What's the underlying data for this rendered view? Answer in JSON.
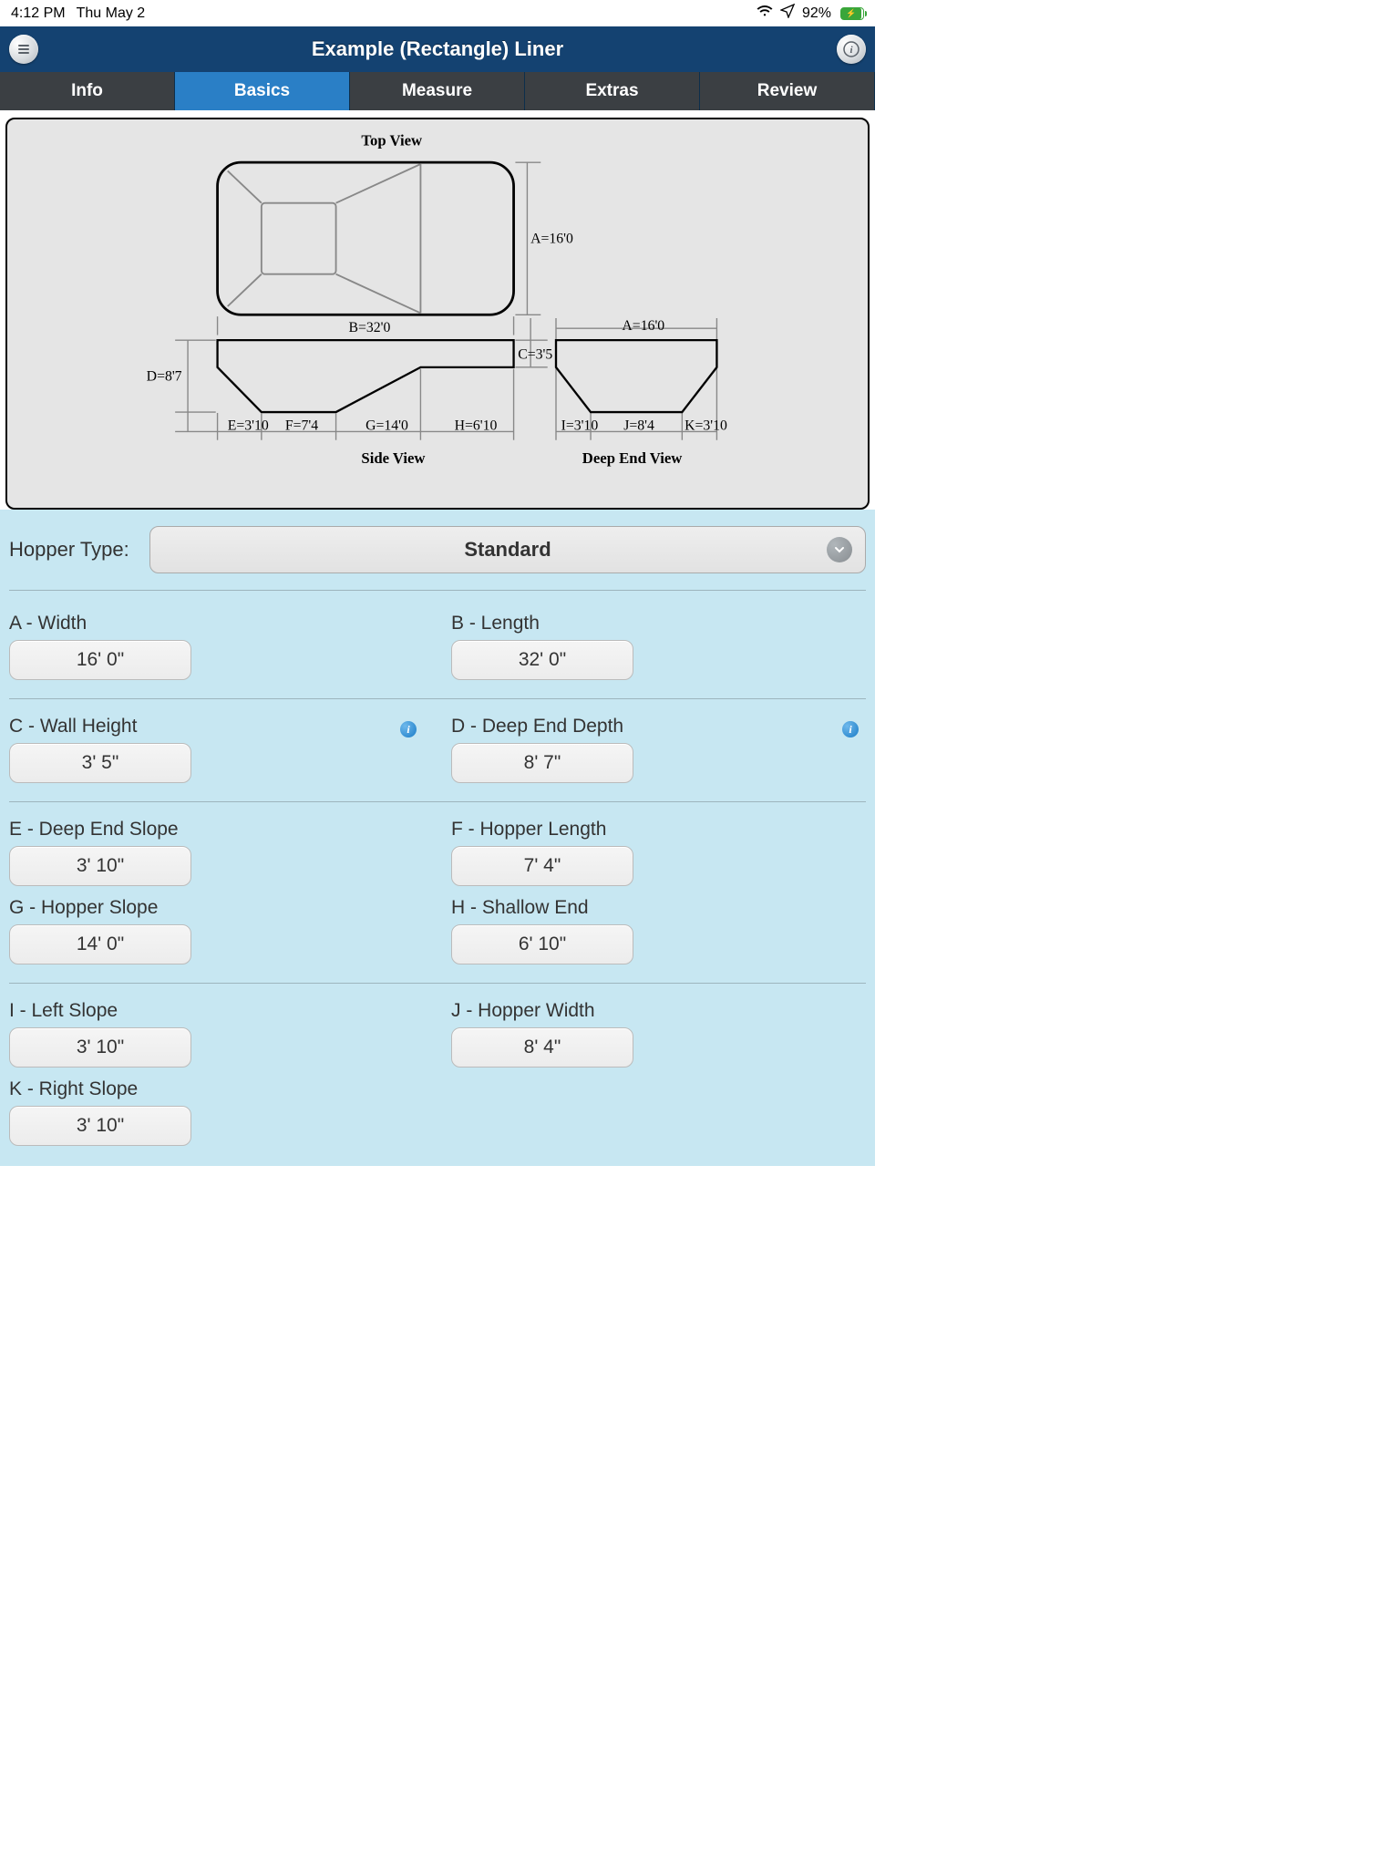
{
  "status": {
    "time": "4:12 PM",
    "date": "Thu May 2",
    "battery_pct": "92%"
  },
  "header": {
    "title": "Example (Rectangle) Liner"
  },
  "tabs": {
    "info": "Info",
    "basics": "Basics",
    "measure": "Measure",
    "extras": "Extras",
    "review": "Review"
  },
  "diagram": {
    "top_view": "Top View",
    "side_view": "Side View",
    "deep_end_view": "Deep End View",
    "labels": {
      "A_top": "A=16'0",
      "A_deep": "A=16'0",
      "B": "B=32'0",
      "C": "C=3'5",
      "D": "D=8'7",
      "E": "E=3'10",
      "F": "F=7'4",
      "G": "G=14'0",
      "H": "H=6'10",
      "I": "I=3'10",
      "J": "J=8'4",
      "K": "K=3'10"
    }
  },
  "hopper": {
    "label": "Hopper Type:",
    "value": "Standard"
  },
  "fields": {
    "A": {
      "label": "A - Width",
      "value": "16' 0\""
    },
    "B": {
      "label": "B - Length",
      "value": "32' 0\""
    },
    "C": {
      "label": "C - Wall Height",
      "value": "3' 5\""
    },
    "D": {
      "label": "D - Deep End Depth",
      "value": "8' 7\""
    },
    "E": {
      "label": "E - Deep End Slope",
      "value": "3' 10\""
    },
    "F": {
      "label": "F - Hopper Length",
      "value": "7' 4\""
    },
    "G": {
      "label": "G - Hopper Slope",
      "value": "14' 0\""
    },
    "H": {
      "label": "H - Shallow End",
      "value": "6' 10\""
    },
    "I": {
      "label": "I - Left Slope",
      "value": "3' 10\""
    },
    "J": {
      "label": "J - Hopper Width",
      "value": "8' 4\""
    },
    "K": {
      "label": "K - Right Slope",
      "value": "3' 10\""
    }
  }
}
